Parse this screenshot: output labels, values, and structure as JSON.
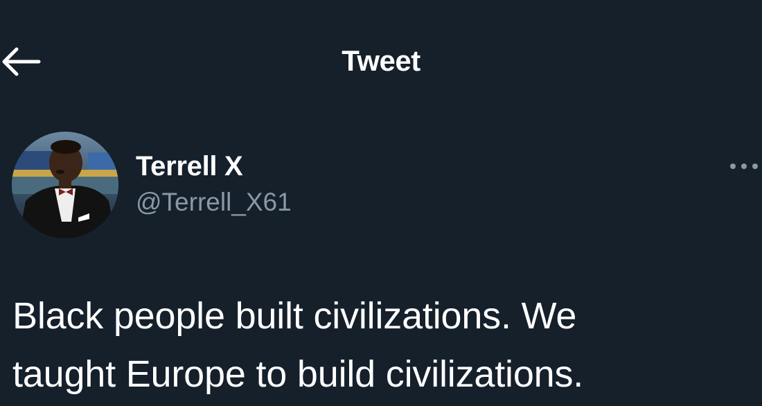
{
  "header": {
    "title": "Tweet",
    "back_icon": "arrow-left-icon"
  },
  "tweet": {
    "author": {
      "display_name": "Terrell X",
      "handle": "@Terrell_X61",
      "avatar": "profile-photo"
    },
    "more_icon": "more-horizontal-icon",
    "text": "Black people built civilizations. We\ntaught Europe to build civilizations."
  },
  "colors": {
    "background": "#15202b",
    "primary_text": "#ffffff",
    "secondary_text": "#8b98a5"
  }
}
